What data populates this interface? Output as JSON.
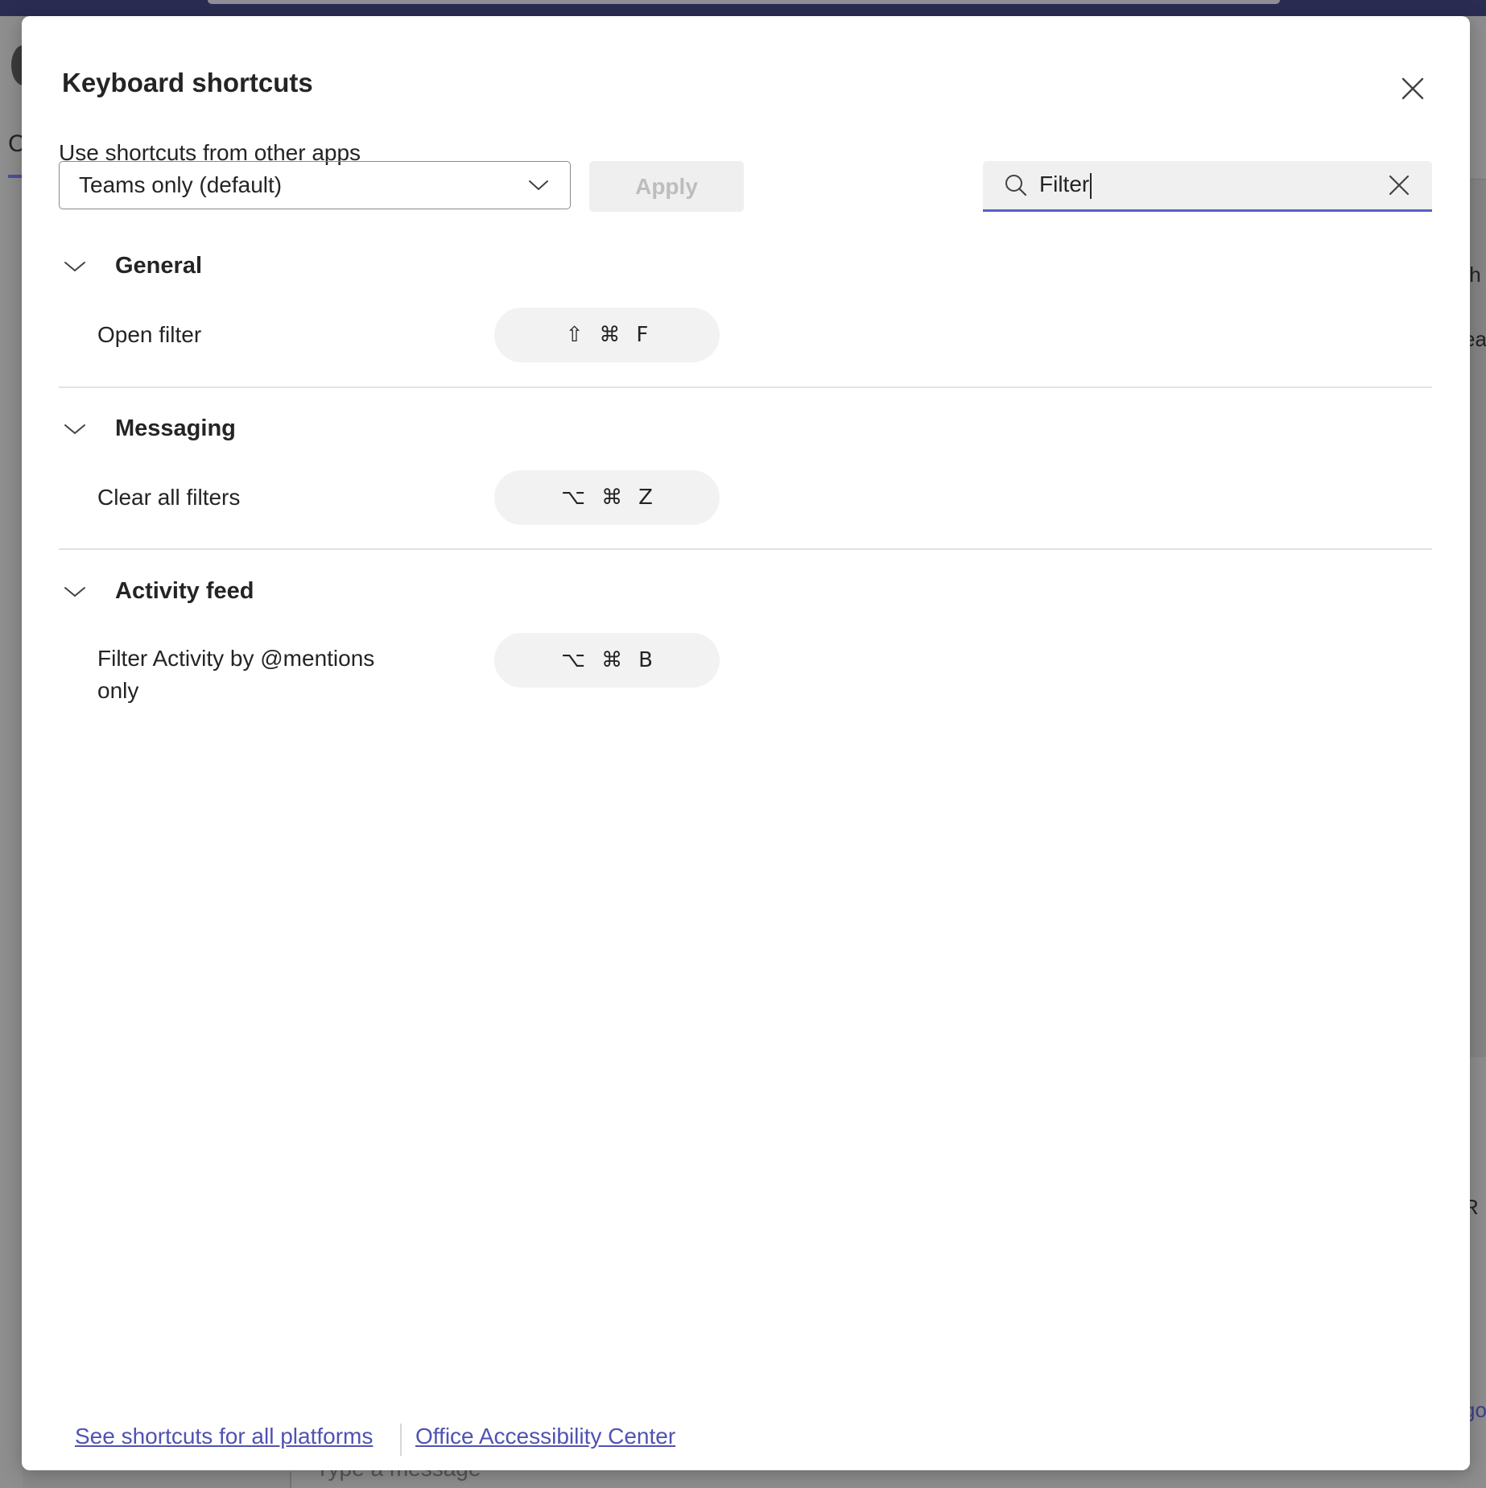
{
  "background": {
    "compose_placeholder": "Type a message",
    "side_letter": "C",
    "right_fragments": [
      "th",
      "ea",
      "R",
      "go"
    ]
  },
  "dialog": {
    "title": "Keyboard shortcuts",
    "close_icon": "close-icon"
  },
  "toolbar": {
    "subtitle": "Use shortcuts from other apps",
    "dropdown_value": "Teams only (default)",
    "apply_label": "Apply",
    "search_value": "Filter"
  },
  "sections": [
    {
      "title": "General",
      "rows": [
        {
          "label": "Open filter",
          "keys": [
            "⇧",
            "⌘",
            "F"
          ]
        }
      ]
    },
    {
      "title": "Messaging",
      "rows": [
        {
          "label": "Clear all filters",
          "keys": [
            "⌥",
            "⌘",
            "Z"
          ]
        }
      ]
    },
    {
      "title": "Activity feed",
      "rows": [
        {
          "label": "Filter Activity by @mentions only",
          "keys": [
            "⌥",
            "⌘",
            "B"
          ]
        }
      ]
    }
  ],
  "footer": {
    "link_platforms": "See shortcuts for all platforms",
    "link_accessibility": "Office Accessibility Center"
  },
  "colors": {
    "accent": "#5b5fc7",
    "link": "#4f52b2",
    "topbar": "#2b2c52"
  }
}
